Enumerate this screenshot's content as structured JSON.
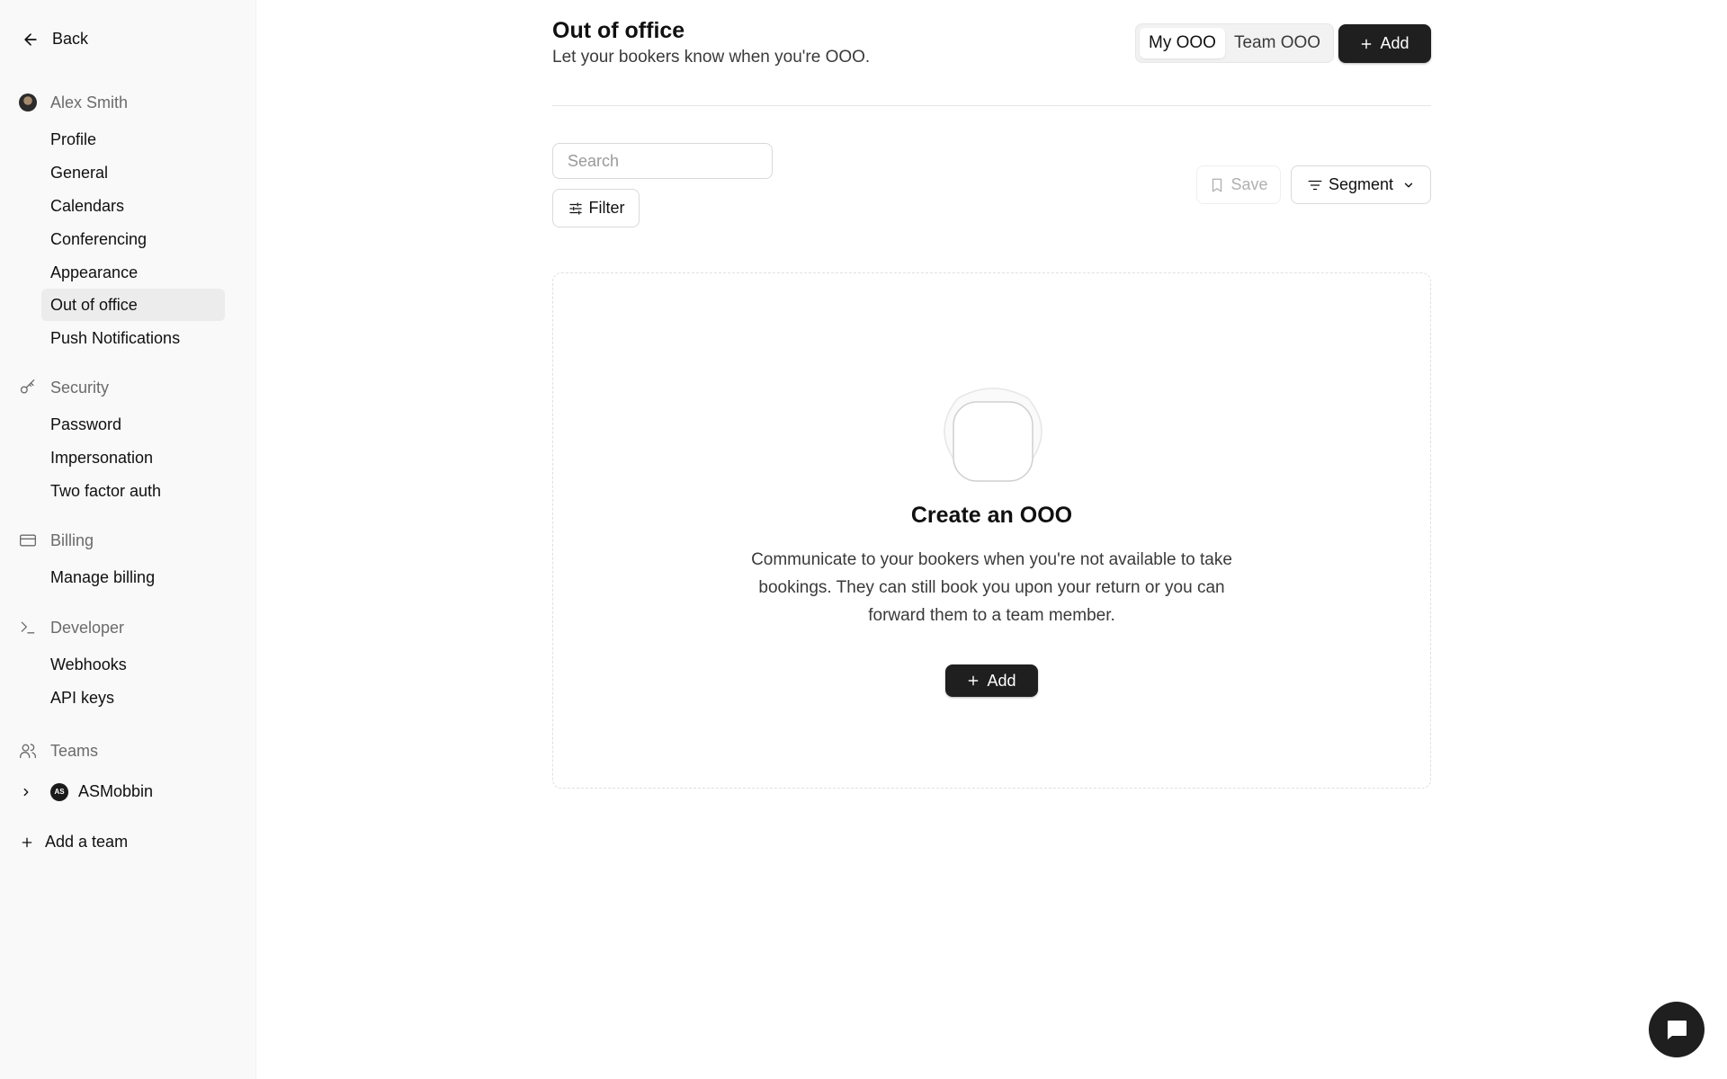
{
  "sidebar": {
    "back_label": "Back",
    "user_section": "Alex Smith",
    "user_items": [
      "Profile",
      "General",
      "Calendars",
      "Conferencing",
      "Appearance",
      "Out of office",
      "Push Notifications"
    ],
    "security_section": "Security",
    "security_items": [
      "Password",
      "Impersonation",
      "Two factor auth"
    ],
    "billing_section": "Billing",
    "billing_items": [
      "Manage billing"
    ],
    "developer_section": "Developer",
    "developer_items": [
      "Webhooks",
      "API keys"
    ],
    "teams_section": "Teams",
    "team_badge": "AS",
    "team_name": "ASMobbin",
    "add_team_label": "Add a team",
    "active_item": "Out of office"
  },
  "header": {
    "title": "Out of office",
    "subtitle": "Let your bookers know when you're OOO.",
    "toggle": [
      "My OOO",
      "Team OOO"
    ],
    "toggle_selected": "My OOO",
    "add_label": "Add"
  },
  "toolbar": {
    "search_placeholder": "Search",
    "filter_label": "Filter",
    "save_label": "Save",
    "segment_label": "Segment"
  },
  "empty_state": {
    "title": "Create an OOO",
    "description": "Communicate to your bookers when you're not available to take bookings. They can still book you upon your return or you can forward them to a team member.",
    "add_label": "Add"
  },
  "icons": {
    "back": "arrow-left-icon",
    "security": "key-icon",
    "billing": "credit-card-icon",
    "developer": "terminal-icon",
    "teams": "users-icon",
    "chat": "chat-icon"
  },
  "colors": {
    "primary": "#1f1f1f",
    "sidebar_bg": "#f9f9f9",
    "active_bg": "#ececec"
  }
}
